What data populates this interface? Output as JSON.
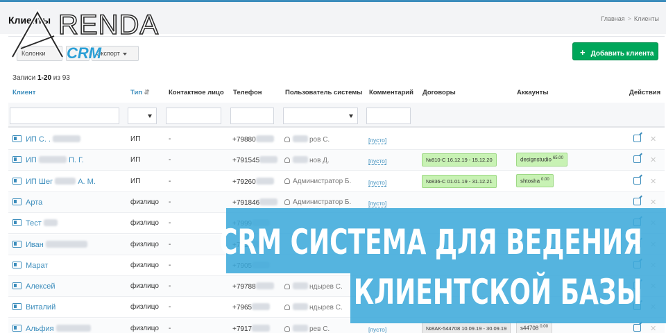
{
  "header": {
    "title": "Клиенты",
    "breadcrumb": [
      "Главная",
      "Клиенты"
    ]
  },
  "logo": {
    "brand": "RENDA",
    "sub": "CRM"
  },
  "toolbar": {
    "columns_label": "Колонки",
    "export_label": "Экспорт",
    "add_label": "Добавить клиента"
  },
  "summary": {
    "prefix": "Записи",
    "range": "1-20",
    "of_label": "из",
    "total": "93"
  },
  "columns": [
    "Клиент",
    "Тип",
    "Контактное лицо",
    "Телефон",
    "Пользователь системы",
    "Комментарий",
    "Договоры",
    "Аккаунты",
    "Действия"
  ],
  "rows": [
    {
      "name": "ИП С. .",
      "type": "ИП",
      "contact": "-",
      "phone": "+79880",
      "user": "ров С.",
      "comment": "[пусто]",
      "contract": "",
      "account": "",
      "account_val": ""
    },
    {
      "name": "ИП",
      "name2": "П. Г.",
      "type": "ИП",
      "contact": "-",
      "phone": "+791545",
      "user": "нов Д.",
      "comment": "[пусто]",
      "contract": "№810-С  16.12.19 - 15.12.20",
      "account": "designstudio",
      "account_val": "65.00"
    },
    {
      "name": "ИП Шег",
      "name2": "А. М.",
      "type": "ИП",
      "contact": "-",
      "phone": "+79260",
      "user": "Администратор Б.",
      "comment": "[пусто]",
      "contract": "№836-С  01.01.19 - 31.12.21",
      "account": "shtosha",
      "account_val": "0.00"
    },
    {
      "name": "Арта",
      "type": "физлицо",
      "contact": "-",
      "phone": "+791846",
      "user": "Администратор Б.",
      "comment": "[пусто]",
      "contract": "",
      "account": "",
      "account_val": ""
    },
    {
      "name": "Тест",
      "type": "физлицо",
      "contact": "-",
      "phone": "+7999",
      "user": "",
      "comment": "",
      "contract": "",
      "account": "",
      "account_val": ""
    },
    {
      "name": "Иван",
      "type": "физлицо",
      "contact": "-",
      "phone": "+7911",
      "user": "",
      "comment": "",
      "contract": "",
      "account": "",
      "account_val": ""
    },
    {
      "name": "Марат",
      "type": "физлицо",
      "contact": "-",
      "phone": "+7905",
      "user": "",
      "comment": "",
      "contract": "",
      "account": "",
      "account_val": ""
    },
    {
      "name": "Алексей",
      "type": "физлицо",
      "contact": "-",
      "phone": "+79788",
      "user": "ндырев С.",
      "comment": "",
      "contract": "",
      "account": "",
      "account_val": ""
    },
    {
      "name": "Виталий",
      "type": "физлицо",
      "contact": "-",
      "phone": "+7965",
      "user": "ндырев С.",
      "comment": "",
      "contract": "",
      "account": "",
      "account_val": ""
    },
    {
      "name": "Альфия",
      "type": "физлицо",
      "contact": "-",
      "phone": "+7917",
      "user": "рев С.",
      "comment": "[пусто]",
      "contract": "№8АК-544708  10.09.19 - 30.09.19",
      "account": "s44708",
      "account_val": "0.00"
    }
  ],
  "banner": {
    "line1": "CRM СИСТЕМА ДЛЯ ВЕДЕНИЯ",
    "line2": "КЛИЕНТСКОЙ БАЗЫ"
  },
  "colors": {
    "accent": "#3c8dbc",
    "add_button": "#00a65a",
    "banner": "#3eaadb",
    "tag_green": "#c8f2b4"
  }
}
